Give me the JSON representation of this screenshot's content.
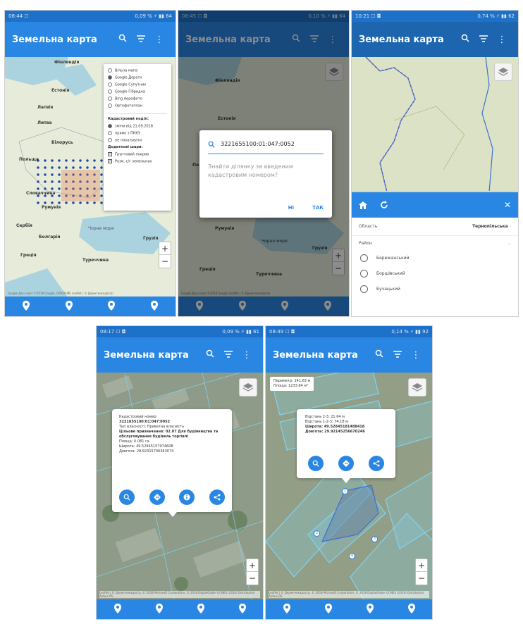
{
  "app": {
    "title": "Земельна карта"
  },
  "colors": {
    "appbar": "#2a86e3",
    "statusbar": "#1d71c9",
    "parcel": "#7fd3f0"
  },
  "screens": [
    {
      "status": {
        "time": "08:44 ☐",
        "right": "0,09 % ⚡ ▮▮ 64"
      },
      "map_labels": [
        "Фінляндія",
        "Естонія",
        "Латвія",
        "Литва",
        "Білорусь",
        "Польща",
        "Словаччина",
        "Румунія",
        "Сербія",
        "Болгарія",
        "Грузія",
        "Греція",
        "Туреччина",
        "Чорне море"
      ],
      "layers": {
        "base": [
          "Вільна мапа",
          "Google Дороги",
          "Google Супутник",
          "Google Гібридна",
          "Bing Аерофото",
          "Ортофотоплан"
        ],
        "cadastral_title": "Кадастровий поділ:",
        "cadastral": [
          "зміни від 21.09.2018",
          "прямо з ПККУ",
          "не показувати"
        ],
        "extra_title": "Додаткові шари:",
        "extra": [
          "Ґрунтовий покрив",
          "Розм. с/г земельних"
        ]
      },
      "attribution": "Google  Дані карт ©2018 Google, ORION-ME  Leaflet | © Держгеокадастр"
    },
    {
      "status": {
        "time": "08:45 ☐ ◘",
        "right": "0,10 % ⚡ ▮▮ 64"
      },
      "search_value": "3221655100:01:047:0052",
      "dialog_text": "Знайти ділянку за введеним кадастровим номером?",
      "btn_no": "НІ",
      "btn_yes": "ТАК",
      "map_labels": [
        "Фінляндія",
        "Естонія",
        "Польща",
        "Румунія",
        "Чорне море",
        "Грузія",
        "Греція",
        "Туреччина"
      ],
      "attribution": "Google  Дані карт ©2018 Google  Leaflet | © Держгеокадастр"
    },
    {
      "status": {
        "time": "10:21 ☐ ◘",
        "right": "0,74 % ⚡ ▮▮ 62"
      },
      "region_label": "Область",
      "region_value": "Тернопільська",
      "district_label": "Район",
      "districts": [
        "Бережанський",
        "Борщівський",
        "Бучацький"
      ]
    },
    {
      "status": {
        "time": "08:17 ☐ ◘",
        "right": "0,09 % ⚡ ▮▮ 61"
      },
      "popup": {
        "lines": [
          "Кадастровий номер:",
          "3221655100:01:047:0052",
          "Тип власності: Приватна власність",
          "Цільове призначення: 02.07 Для будівництва та обслуговування будівель торгівлі",
          "Площа: 0.081 га",
          "Широта: 49.52945157974608",
          "Довгота: 29.92315706363074"
        ]
      },
      "attribution": "Leaflet | © Держгеокадастр, © 2018 Microsoft Corporation, © 2018 DigitalGlobe ©CNES (2018) Distribution Airbus DS"
    },
    {
      "status": {
        "time": "08:49 ☐ ◘",
        "right": "0,14 % ⚡ ▮▮ 92"
      },
      "measure": {
        "perimeter": "Периметр: 141.63 м",
        "area": "Площа: 1233.84 м²"
      },
      "popup": {
        "lines": [
          "Відстань 2-3: 21.64 м",
          "Відстань 1-2-3: 74.18 м",
          "Широта: 49.52845181488418",
          "Довгота: 29.92145256670246"
        ]
      },
      "vertices": [
        "1",
        "2",
        "3",
        "4"
      ],
      "attribution": "Leaflet | © Держгеокадастр, © 2018 Microsoft Corporation, © 2018 DigitalGlobe ©CNES (2018) Distribution Airbus DS"
    }
  ]
}
